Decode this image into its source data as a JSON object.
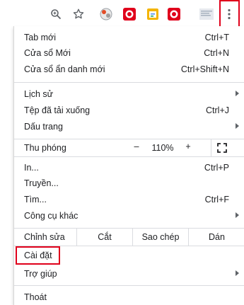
{
  "menu": {
    "new_tab": {
      "label": "Tab mới",
      "shortcut": "Ctrl+T"
    },
    "new_window": {
      "label": "Cửa sổ Mới",
      "shortcut": "Ctrl+N"
    },
    "incognito": {
      "label": "Cửa sổ ẩn danh mới",
      "shortcut": "Ctrl+Shift+N"
    },
    "history": {
      "label": "Lịch sử"
    },
    "downloads": {
      "label": "Tệp đã tải xuống",
      "shortcut": "Ctrl+J"
    },
    "bookmarks": {
      "label": "Dấu trang"
    },
    "zoom": {
      "label": "Thu phóng",
      "minus": "–",
      "value": "110%",
      "plus": "+"
    },
    "print": {
      "label": "In...",
      "shortcut": "Ctrl+P"
    },
    "cast": {
      "label": "Truyền..."
    },
    "find": {
      "label": "Tìm...",
      "shortcut": "Ctrl+F"
    },
    "more_tools": {
      "label": "Công cụ khác"
    },
    "edit": {
      "label": "Chỉnh sửa",
      "cut": "Cắt",
      "copy": "Sao chép",
      "paste": "Dán"
    },
    "settings": {
      "label": "Cài đặt"
    },
    "help": {
      "label": "Trợ giúp"
    },
    "exit": {
      "label": "Thoát"
    }
  },
  "colors": {
    "highlight": "#e0001b",
    "separator": "#dadce0"
  }
}
